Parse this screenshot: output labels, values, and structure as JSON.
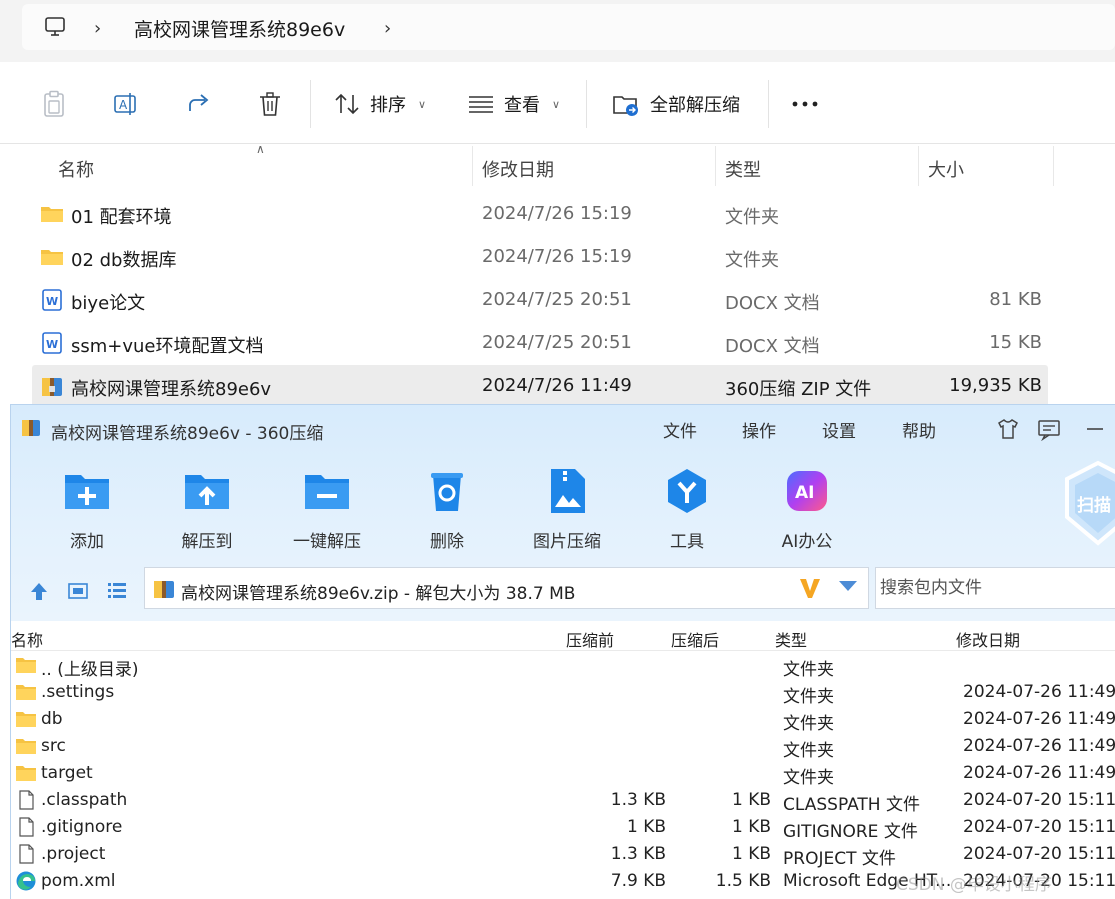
{
  "explorer": {
    "breadcrumb": "高校网课管理系统89e6v",
    "toolbar": {
      "sort_label": "排序",
      "view_label": "查看",
      "extract_all_label": "全部解压缩"
    },
    "columns": {
      "name": "名称",
      "modified": "修改日期",
      "type": "类型",
      "size": "大小"
    },
    "files": [
      {
        "name": "01 配套环境",
        "modified": "2024/7/26 15:19",
        "type": "文件夹",
        "size": "",
        "icon": "folder-icon"
      },
      {
        "name": "02 db数据库",
        "modified": "2024/7/26 15:19",
        "type": "文件夹",
        "size": "",
        "icon": "folder-icon"
      },
      {
        "name": "biye论文",
        "modified": "2024/7/25 20:51",
        "type": "DOCX 文档",
        "size": "81 KB",
        "icon": "word-doc-icon"
      },
      {
        "name": "ssm+vue环境配置文档",
        "modified": "2024/7/25 20:51",
        "type": "DOCX 文档",
        "size": "15 KB",
        "icon": "word-doc-icon"
      },
      {
        "name": "高校网课管理系统89e6v",
        "modified": "2024/7/26 11:49",
        "type": "360压缩 ZIP 文件",
        "size": "19,935 KB",
        "icon": "zip-archive-icon"
      }
    ]
  },
  "zip_window": {
    "title": "高校网课管理系统89e6v - 360压缩",
    "menu": [
      "文件",
      "操作",
      "设置",
      "帮助"
    ],
    "tools": [
      "添加",
      "解压到",
      "一键解压",
      "删除",
      "图片压缩",
      "工具",
      "AI办公"
    ],
    "path_text": "高校网课管理系统89e6v.zip - 解包大小为 38.7 MB",
    "search_placeholder": "搜索包内文件",
    "columns": {
      "name": "名称",
      "compressed_before": "压缩前",
      "compressed_after": "压缩后",
      "type": "类型",
      "modified": "修改日期"
    },
    "entries": [
      {
        "name": ".. (上级目录)",
        "before": "",
        "after": "",
        "type": "文件夹",
        "modified": "",
        "icon": "folder-icon"
      },
      {
        "name": ".settings",
        "before": "",
        "after": "",
        "type": "文件夹",
        "modified": "2024-07-26 11:49",
        "icon": "folder-icon"
      },
      {
        "name": "db",
        "before": "",
        "after": "",
        "type": "文件夹",
        "modified": "2024-07-26 11:49",
        "icon": "folder-icon"
      },
      {
        "name": "src",
        "before": "",
        "after": "",
        "type": "文件夹",
        "modified": "2024-07-26 11:49",
        "icon": "folder-icon"
      },
      {
        "name": "target",
        "before": "",
        "after": "",
        "type": "文件夹",
        "modified": "2024-07-26 11:49",
        "icon": "folder-icon"
      },
      {
        "name": ".classpath",
        "before": "1.3 KB",
        "after": "1 KB",
        "type": "CLASSPATH 文件",
        "modified": "2024-07-20 15:11",
        "icon": "file-icon"
      },
      {
        "name": ".gitignore",
        "before": "1 KB",
        "after": "1 KB",
        "type": "GITIGNORE 文件",
        "modified": "2024-07-20 15:11",
        "icon": "file-icon"
      },
      {
        "name": ".project",
        "before": "1.3 KB",
        "after": "1 KB",
        "type": "PROJECT 文件",
        "modified": "2024-07-20 15:11",
        "icon": "file-icon"
      },
      {
        "name": "pom.xml",
        "before": "7.9 KB",
        "after": "1.5 KB",
        "type": "Microsoft Edge HT...",
        "modified": "2024-07-20 15:11",
        "icon": "edge-icon"
      }
    ]
  },
  "watermark": "CSDN @毕设小程序",
  "colors": {
    "folder": "#f6c343",
    "accent_blue": "#2f8fe6",
    "zip_top_bg": "#dcedfc",
    "selected_row": "#ececec"
  }
}
